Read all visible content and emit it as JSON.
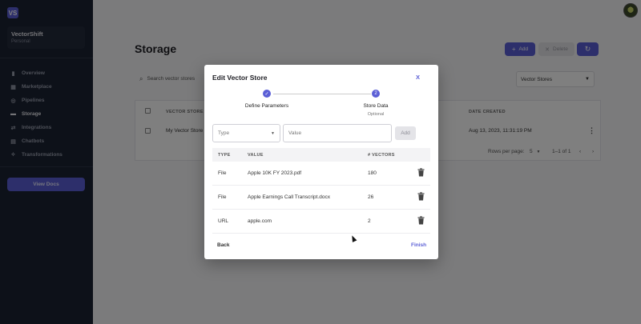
{
  "app": {
    "logo": "VS"
  },
  "org": {
    "name": "VectorShift",
    "plan": "Personal"
  },
  "sidebar": {
    "items": [
      {
        "label": "Overview",
        "icon": "bar-chart-icon",
        "glyph": "▮"
      },
      {
        "label": "Marketplace",
        "icon": "store-icon",
        "glyph": "▦"
      },
      {
        "label": "Pipelines",
        "icon": "pipeline-icon",
        "glyph": "◎"
      },
      {
        "label": "Storage",
        "icon": "folder-icon",
        "glyph": "▬"
      },
      {
        "label": "Integrations",
        "icon": "arrows-icon",
        "glyph": "⇄"
      },
      {
        "label": "Chatbots",
        "icon": "chat-icon",
        "glyph": "▤"
      },
      {
        "label": "Transformations",
        "icon": "transform-icon",
        "glyph": "⟡"
      }
    ],
    "active": "Storage",
    "view_docs": "View Docs"
  },
  "page": {
    "title": "Storage",
    "add_label": "Add",
    "delete_label": "Delete",
    "search_placeholder": "Search vector stores",
    "filter_value": "Vector Stores",
    "table": {
      "headers": [
        "VECTOR STORE NA",
        "DATE CREATED"
      ],
      "rows": [
        {
          "name": "My Vector Store",
          "date": "Aug 13, 2023, 11:31:19 PM"
        }
      ]
    },
    "pager": {
      "rows_per_page_label": "Rows per page:",
      "rows_per_page": "5",
      "range": "1–1 of 1"
    }
  },
  "modal": {
    "title": "Edit Vector Store",
    "close": "X",
    "steps": [
      {
        "number": "1",
        "label": "Define Parameters",
        "status": "complete"
      },
      {
        "number": "2",
        "label": "Store Data",
        "sub": "Optional",
        "status": "active"
      }
    ],
    "type_placeholder": "Type",
    "value_placeholder": "Value",
    "add_label": "Add",
    "table": {
      "headers": {
        "type": "TYPE",
        "value": "VALUE",
        "vectors": "# VECTORS"
      },
      "rows": [
        {
          "type": "File",
          "value": "Apple 10K FY 2023.pdf",
          "vectors": "180"
        },
        {
          "type": "File",
          "value": "Apple Earnings Call Transcript.docx",
          "vectors": "26"
        },
        {
          "type": "URL",
          "value": "apple.com",
          "vectors": "2"
        }
      ]
    },
    "back_label": "Back",
    "finish_label": "Finish"
  },
  "colors": {
    "accent": "#5b5fd6",
    "sidebar": "#1b2233"
  }
}
